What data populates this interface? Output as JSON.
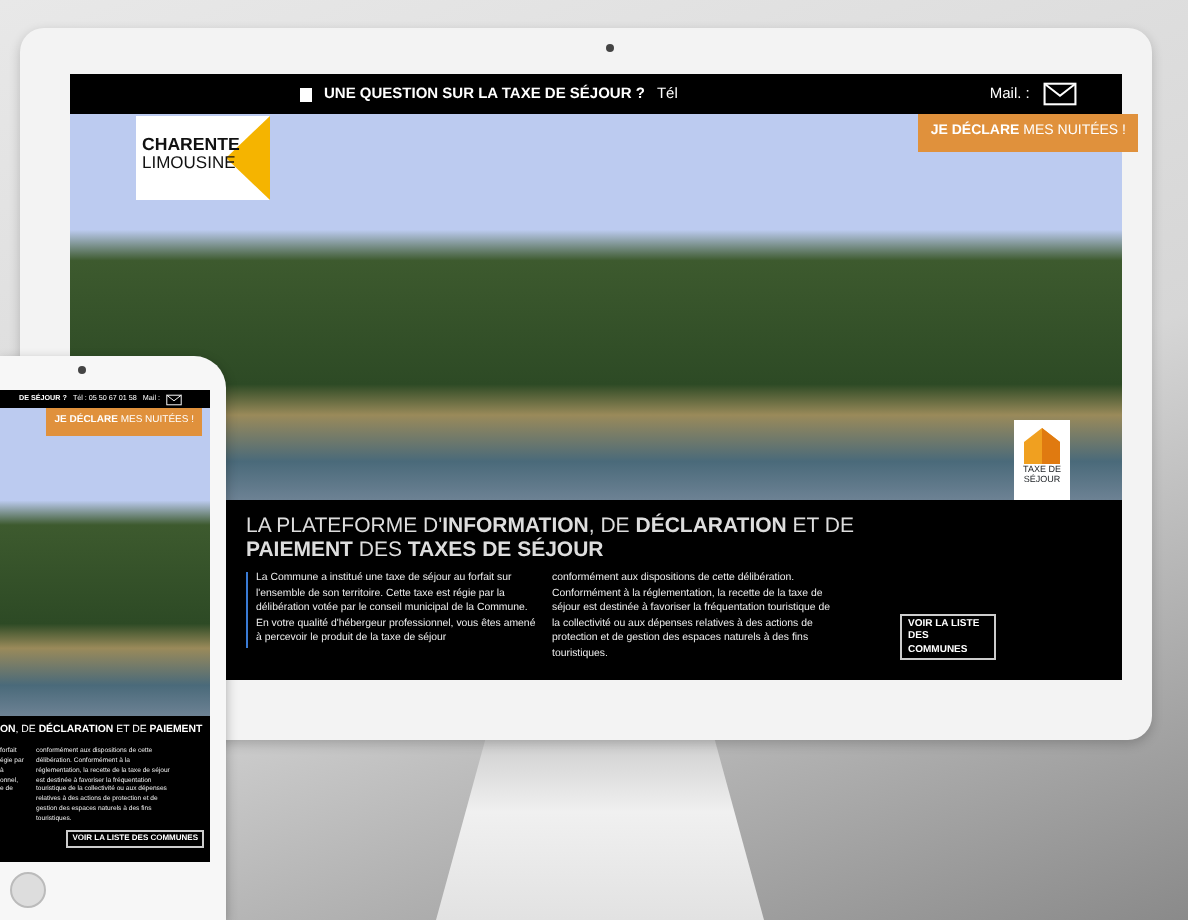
{
  "desktop": {
    "topbar": {
      "question": "UNE QUESTION SUR LA TAXE DE SÉJOUR ?",
      "phone_label": "Tél",
      "mail_label": "Mail. :"
    },
    "declare_button": "**JE DÉCLARE** MES NUITÉES !",
    "logo": {
      "line_1": "CHARENTE",
      "line_2": "LIMOUSINE"
    },
    "badge": {
      "line_1": "TAXE DE",
      "line_2": "SÉJOUR"
    },
    "heading": "LA PLATEFORME D'**INFORMATION**, DE **DÉCLARATION** ET DE **PAIEMENT** DES **TAXES DE SÉJOUR**",
    "paragraph_1": "La Commune  a institué une taxe de séjour au forfait sur l'ensemble de son territoire. Cette taxe est régie par la délibération votée par le conseil municipal de la Commune. En votre qualité d'hébergeur professionnel, vous êtes amené à percevoir le produit de la taxe de séjour",
    "paragraph_2": "conformément aux dispositions de cette délibération. Conformément à la réglementation, la recette de la taxe de séjour est destinée à favoriser la fréquentation touristique de la collectivité ou aux dépenses relatives à des actions de protection et de gestion des espaces naturels à des fins touristiques.",
    "list_button": "VOIR LA LISTE DES COMMUNES"
  },
  "tablet": {
    "topbar": {
      "question": "DE SÉJOUR ?",
      "phone": "Tél : 05 50 67 01 58",
      "mail_label": "Mail :"
    },
    "declare_button": "**JE DÉCLARE** MES NUITÉES !",
    "heading": "**ON**, DE **DÉCLARATION** ET DE **PAIEMENT**",
    "left_fragments": [
      "forfait",
      "égie par",
      "à",
      "onnel,",
      "e de"
    ],
    "paragraph": "conformément aux dispositions de cette délibération. Conformément à la réglementation, la recette de la taxe de séjour est destinée à favoriser la fréquentation touristique de la collectivité ou aux dépenses relatives à des actions de protection et de gestion des espaces naturels à des fins touristiques.",
    "list_button": "VOIR LA LISTE DES COMMUNES"
  }
}
